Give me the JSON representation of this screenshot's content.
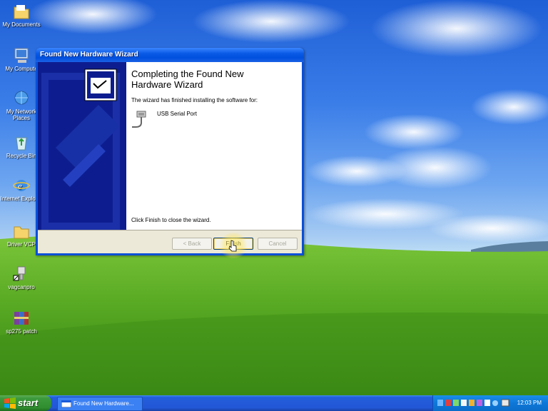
{
  "desktop_icons": [
    {
      "label": "My Documents",
      "icon": "folder-icon"
    },
    {
      "label": "My Compute",
      "icon": "computer-icon"
    },
    {
      "label": "My Network Places",
      "icon": "network-icon"
    },
    {
      "label": "Recycle Bin",
      "icon": "recycle-bin-icon"
    },
    {
      "label": "Internet Explorer",
      "icon": "internet-explorer-icon"
    },
    {
      "label": "Driver VCP",
      "icon": "folder-icon"
    },
    {
      "label": "vagcanpro",
      "icon": "shortcut-icon"
    },
    {
      "label": "sp275 patch",
      "icon": "archive-icon"
    }
  ],
  "window": {
    "title": "Found New Hardware Wizard",
    "heading": "Completing the Found New Hardware Wizard",
    "subtext": "The wizard has finished installing the software for:",
    "device": "USB Serial Port",
    "close_text": "Click Finish to close the wizard.",
    "buttons": {
      "back": "< Back",
      "finish": "Finish",
      "cancel": "Cancel"
    }
  },
  "taskbar": {
    "start_label": "start",
    "task_label": "Found New Hardware...",
    "clock": "12:03 PM"
  },
  "colors": {
    "title_bar": "#0a5ae6",
    "taskbar": "#245edb",
    "start_button": "#3c9a3c",
    "wizard_panel": "#0d1d8f"
  }
}
